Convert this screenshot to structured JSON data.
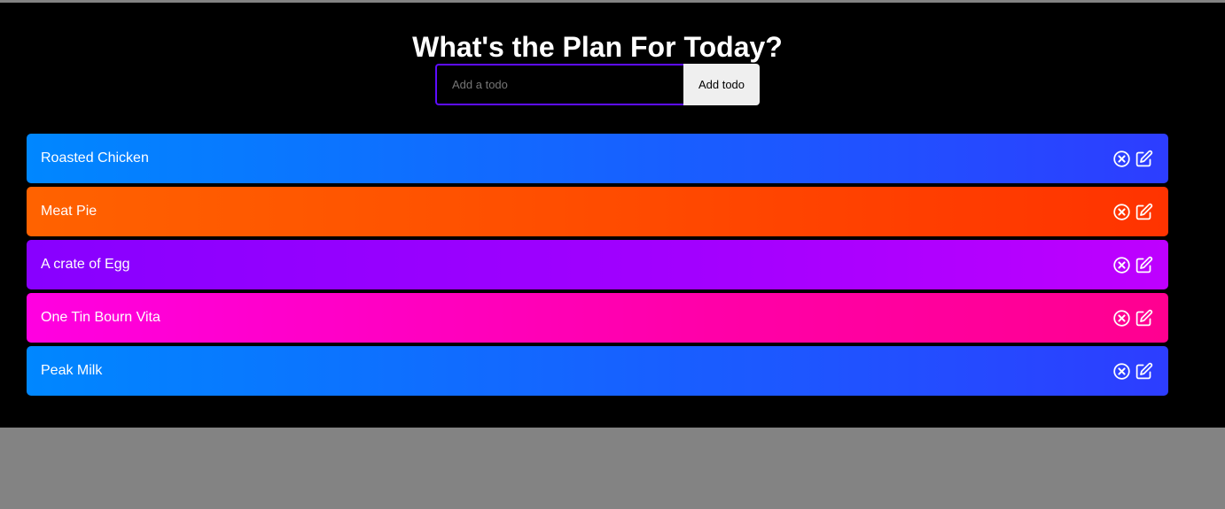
{
  "header": {
    "title": "What's the Plan For Today?"
  },
  "form": {
    "input_placeholder": "Add a todo",
    "input_value": "",
    "add_button_label": "Add todo"
  },
  "todos": [
    {
      "text": "Roasted Chicken",
      "color": "#0087ff"
    },
    {
      "text": "Meat Pie",
      "color": "#ff6200"
    },
    {
      "text": "A crate of Egg",
      "color": "#8800ff"
    },
    {
      "text": "One Tin Bourn Vita",
      "color": "#ff00e1"
    },
    {
      "text": "Peak Milk",
      "color": "#0087ff"
    }
  ],
  "icons": {
    "delete": "close-circle-icon",
    "edit": "edit-icon"
  },
  "colors": {
    "background": "#000000",
    "input_border": "#5d0cff",
    "page_surround": "#838383"
  }
}
